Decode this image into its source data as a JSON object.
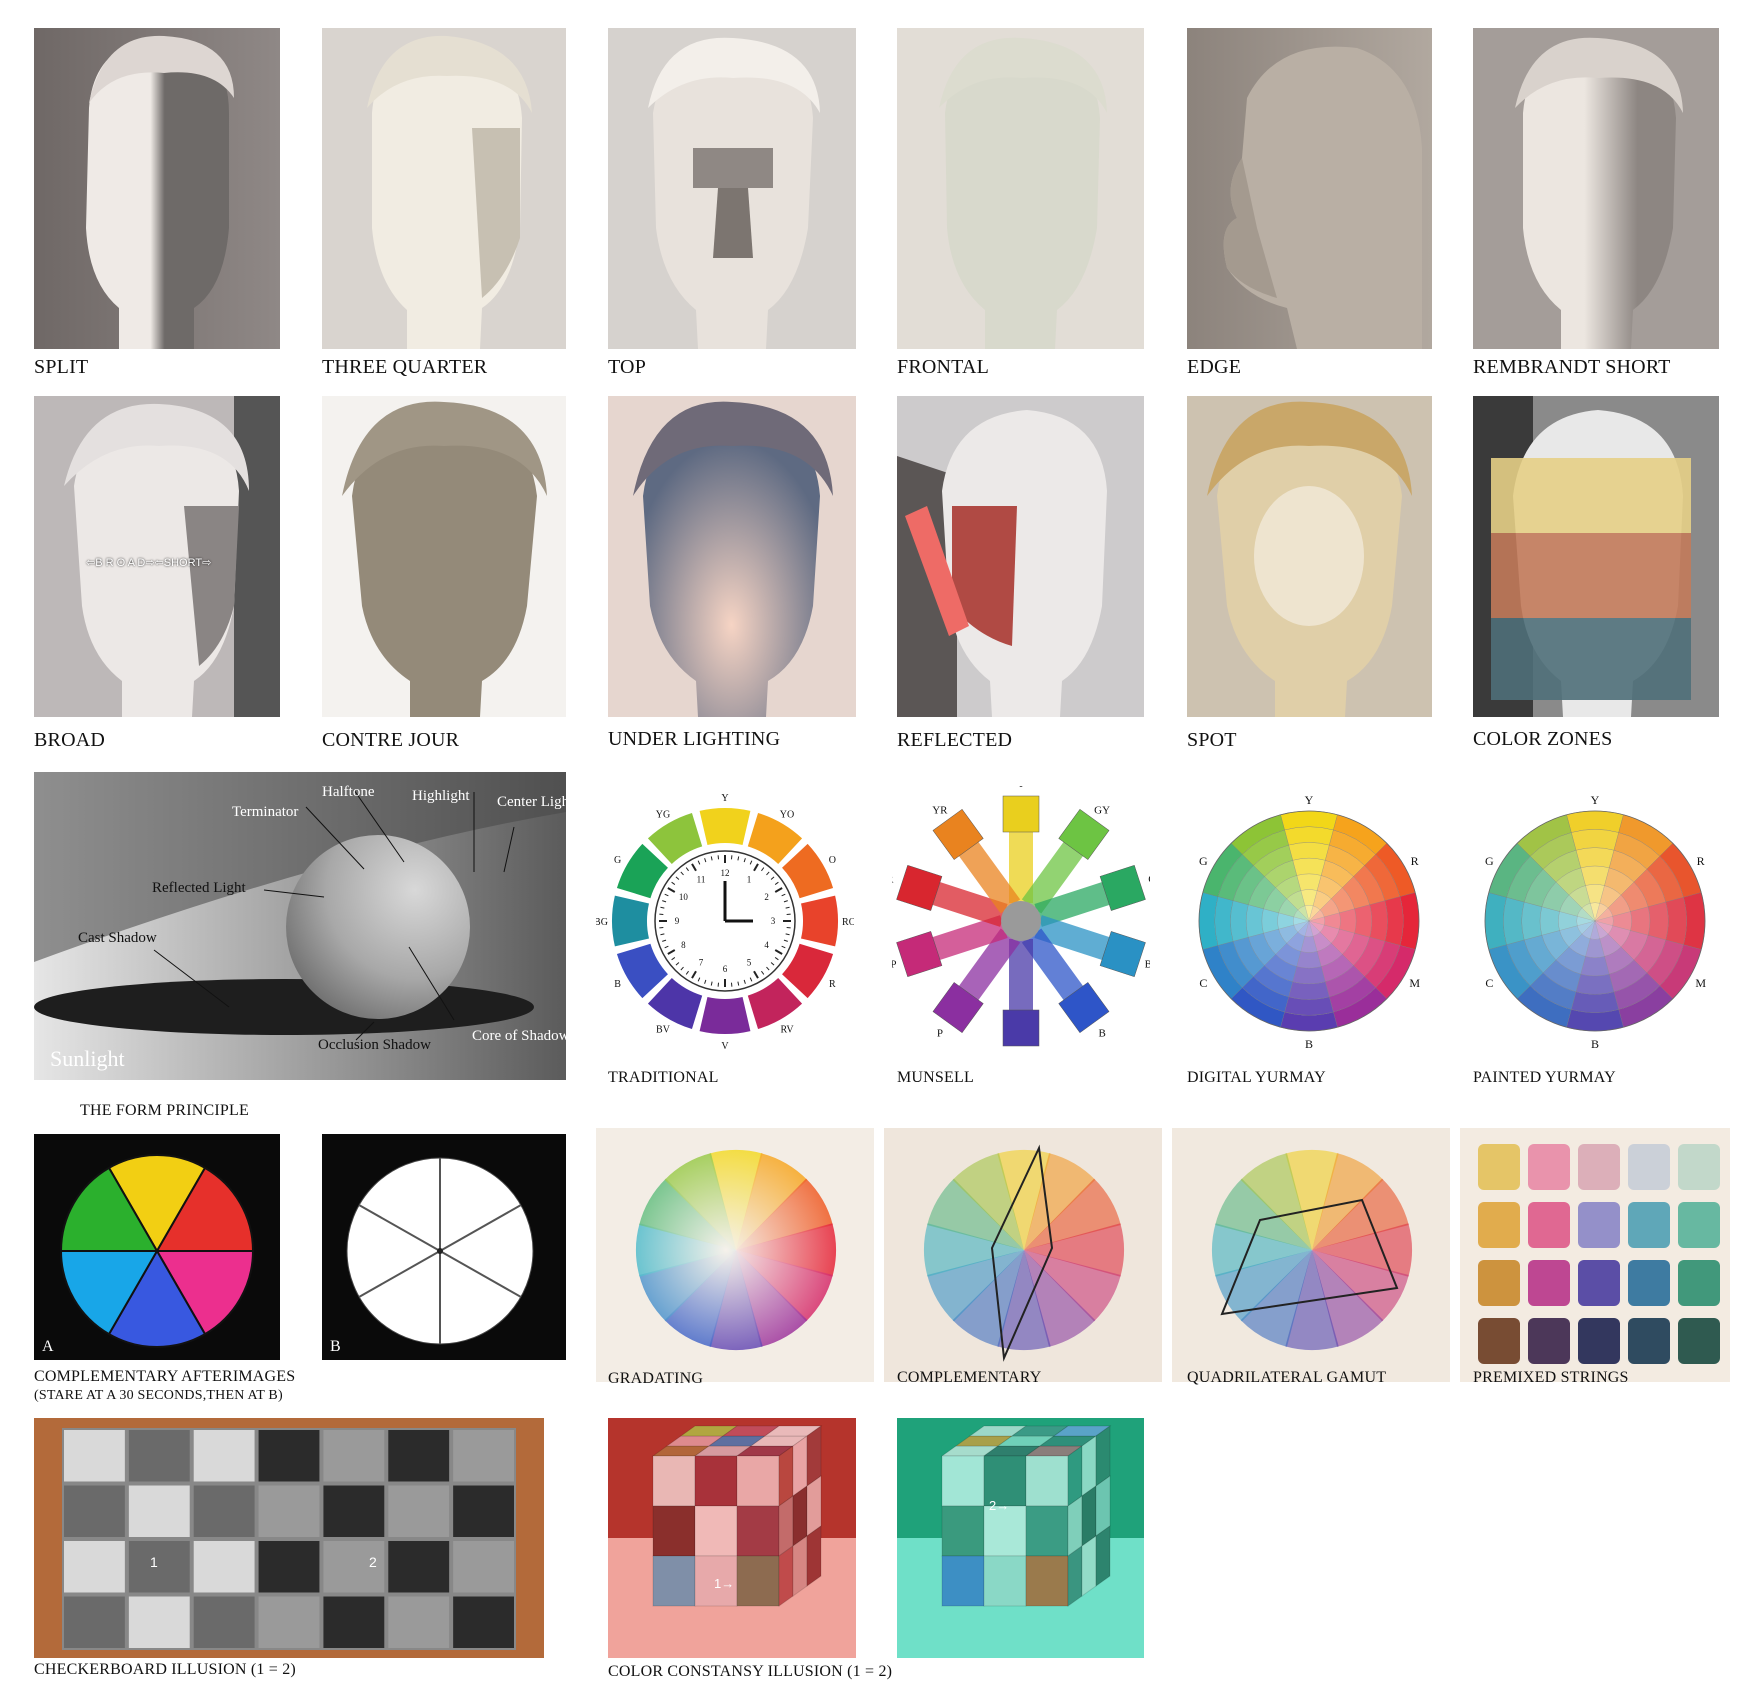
{
  "lighting_row_1": [
    {
      "caption": "SPLIT"
    },
    {
      "caption": "THREE QUARTER"
    },
    {
      "caption": "TOP"
    },
    {
      "caption": "FRONTAL"
    },
    {
      "caption": "EDGE"
    },
    {
      "caption": "REMBRANDT SHORT"
    }
  ],
  "lighting_row_2": [
    {
      "caption": "BROAD",
      "overlay_text": "⇦B R O A D⇨⇦SHORT⇨"
    },
    {
      "caption": "CONTRE JOUR"
    },
    {
      "caption": "UNDER LIGHTING"
    },
    {
      "caption": "REFLECTED"
    },
    {
      "caption": "SPOT"
    },
    {
      "caption": "COLOR ZONES"
    }
  ],
  "form_principle": {
    "caption": "THE FORM PRINCIPLE",
    "labels": {
      "halftone": "Halftone",
      "highlight": "Highlight",
      "center_light": "Center Light",
      "terminator": "Terminator",
      "reflected_light": "Reflected Light",
      "cast_shadow": "Cast Shadow",
      "sunlight": "Sunlight",
      "occlusion_shadow": "Occlusion Shadow",
      "core_of_shadow": "Core of Shadow"
    }
  },
  "wheels": {
    "traditional": {
      "caption": "TRADITIONAL",
      "labels": [
        "Y",
        "YO",
        "O",
        "RO",
        "R",
        "RV",
        "V",
        "BV",
        "B",
        "BG",
        "G",
        "YG"
      ],
      "colors": [
        "#f1d21c",
        "#f4a11c",
        "#ee6b21",
        "#e8432b",
        "#d9283a",
        "#c2245c",
        "#7a2b9a",
        "#4d35a8",
        "#3a4fc2",
        "#1e8ea0",
        "#1aa357",
        "#8dc43c"
      ],
      "clock_numbers": [
        "12",
        "1",
        "2",
        "3",
        "4",
        "5",
        "6",
        "7",
        "8",
        "9",
        "10",
        "11"
      ]
    },
    "munsell": {
      "caption": "MUNSELL",
      "labels": [
        "Y",
        "GY",
        "G",
        "BG",
        "B",
        "PB",
        "P",
        "RP",
        "R",
        "YR"
      ],
      "colors": [
        "#e9cf1e",
        "#6dc443",
        "#2aa862",
        "#2a91c4",
        "#2e55c8",
        "#4a3aa8",
        "#8b2fa0",
        "#c52a78",
        "#d8262f",
        "#e9831f"
      ]
    },
    "digital_yurmay": {
      "caption": "DIGITAL YURMAY",
      "labels": [
        "Y",
        "R",
        "M",
        "B",
        "C",
        "G"
      ],
      "colors": [
        "#f2d718",
        "#f6a31c",
        "#ee5a26",
        "#e5263a",
        "#d52a6a",
        "#9a2e9a",
        "#5a3db0",
        "#3057c4",
        "#2f82c8",
        "#2fb0c6",
        "#4ab56d",
        "#8dc436"
      ]
    },
    "painted_yurmay": {
      "caption": "PAINTED YURMAY",
      "labels": [
        "Y",
        "R",
        "M",
        "B",
        "C",
        "G"
      ],
      "colors": [
        "#f0cf2a",
        "#f0992c",
        "#e8552d",
        "#de3444",
        "#c83a78",
        "#8a3fa0",
        "#5548b0",
        "#3e6ec0",
        "#3a93c6",
        "#3fb0bf",
        "#5ab582",
        "#a1c346"
      ]
    }
  },
  "afterimages": {
    "caption_line1": "COMPLEMENTARY AFTERIMAGES",
    "caption_line2": "(STARE AT A 30 SECONDS,THEN AT B)",
    "panel_a_letter": "A",
    "panel_b_letter": "B",
    "colors": [
      "#f2cf13",
      "#e6302b",
      "#ec2f8e",
      "#3858e0",
      "#18a6e8",
      "#2bb02d"
    ]
  },
  "gamut_row": [
    {
      "caption": "GRADATING"
    },
    {
      "caption": "COMPLEMENTARY"
    },
    {
      "caption": "QUADRILATERAL GAMUT"
    },
    {
      "caption": "PREMIXED STRINGS"
    }
  ],
  "illusions": {
    "checkerboard_caption": "CHECKERBOARD ILLUSION (1 = 2)",
    "checker_mark_1": "1",
    "checker_mark_2": "2",
    "constancy_caption": "COLOR CONSTANSY ILLUSION (1 = 2)",
    "constancy_mark_1": "1→",
    "constancy_mark_2": "2→"
  }
}
